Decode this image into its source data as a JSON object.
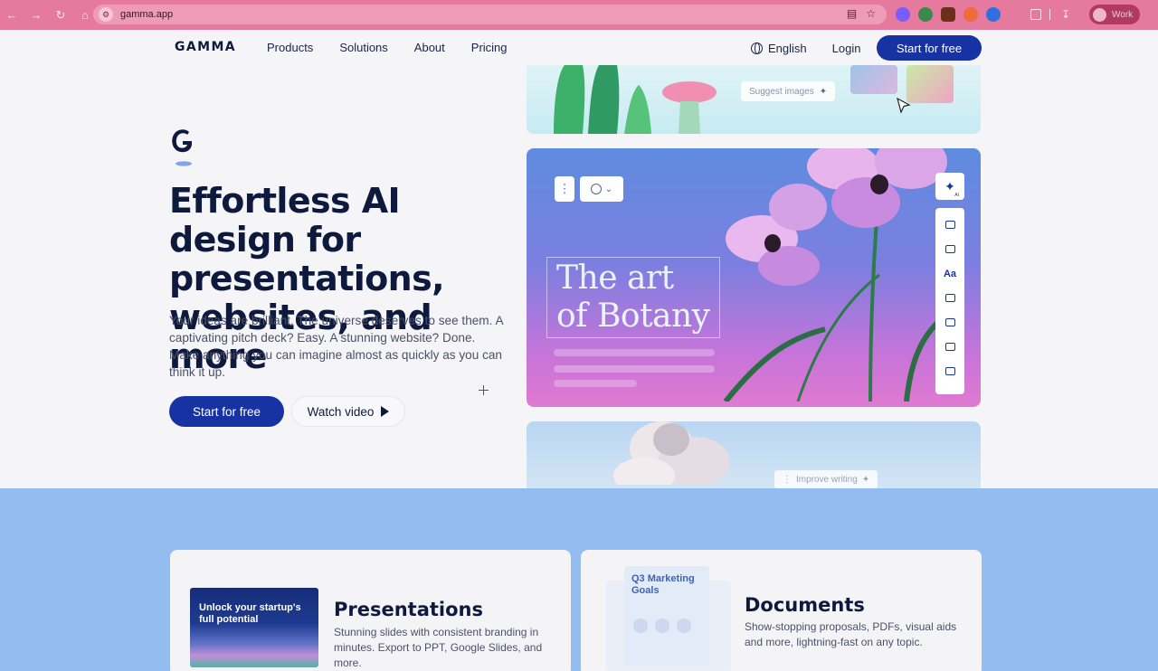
{
  "browser": {
    "url": "gamma.app",
    "profile_name": "Work",
    "extension_colors": [
      "#7b5cff",
      "#3a8a4e",
      "#6b2f1a",
      "#ef6b3a",
      "#2f6fe0"
    ]
  },
  "nav": {
    "logo": "GAMMA",
    "links": [
      "Products",
      "Solutions",
      "About",
      "Pricing"
    ],
    "language": "English",
    "login": "Login",
    "cta": "Start for free"
  },
  "hero": {
    "title": "Effortless AI design for presentations, websites, and more",
    "subtitle": "Your ideas are brilliant. The universe deserves to see them. A captivating pitch deck? Easy. A stunning website? Done. Make anything you can imagine almost as quickly as you can think it up.",
    "primary_cta": "Start for free",
    "secondary_cta": "Watch video"
  },
  "cards": {
    "suggest_label": "Suggest images",
    "art_title_line1": "The art",
    "art_title_line2": "of Botany",
    "improve_label": "Improve writing",
    "ai_badge": "AI"
  },
  "features": [
    {
      "thumb_text": "Unlock your startup's full potential",
      "title": "Presentations",
      "desc": "Stunning slides with consistent branding in minutes. Export to PPT, Google Slides, and more."
    },
    {
      "thumb_text": "Q3 Marketing Goals",
      "title": "Documents",
      "desc": "Show-stopping proposals, PDFs, visual aids and more, lightning-fast on any topic."
    }
  ],
  "colors": {
    "brand_blue": "#1732a3",
    "chrome_pink": "#e5799e",
    "lower_bg": "#93bdf0"
  }
}
